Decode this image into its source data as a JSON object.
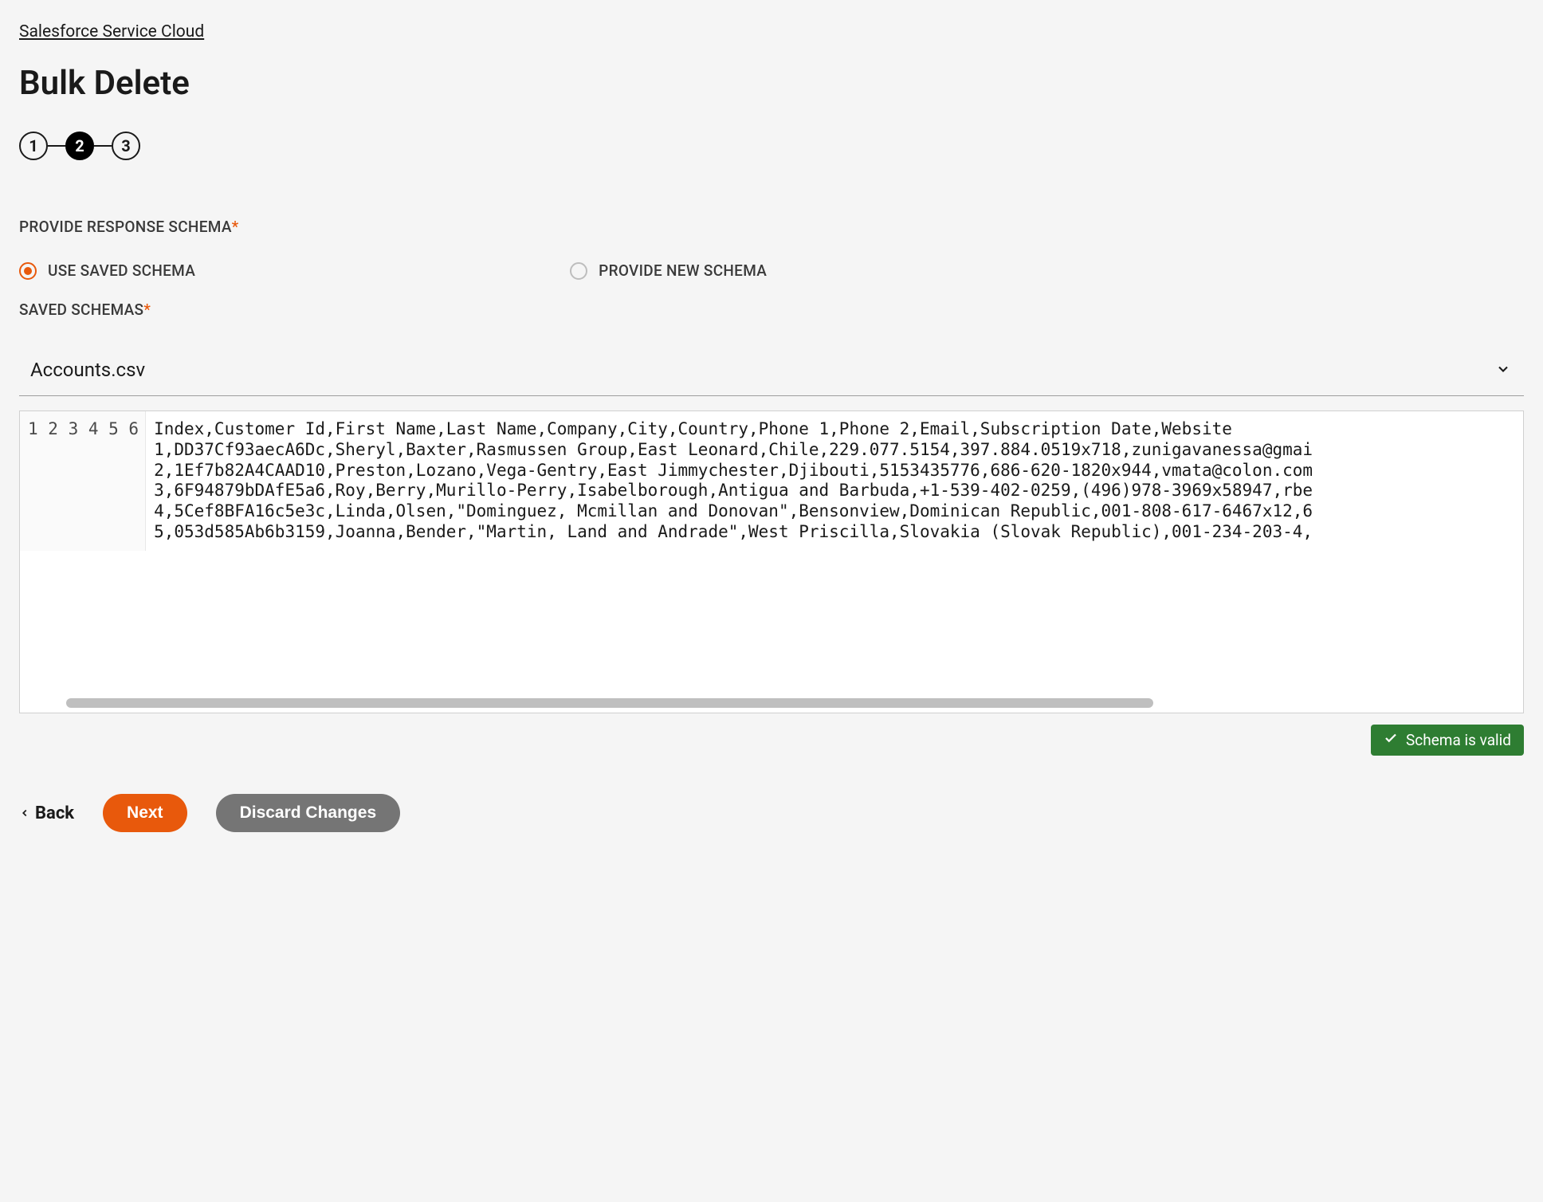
{
  "breadcrumb": "Salesforce Service Cloud",
  "title": "Bulk Delete",
  "stepper": {
    "steps": [
      "1",
      "2",
      "3"
    ],
    "active_index": 1
  },
  "schema_section": {
    "label": "PROVIDE RESPONSE SCHEMA",
    "options": {
      "use_saved": "USE SAVED SCHEMA",
      "provide_new": "PROVIDE NEW SCHEMA"
    },
    "selected": "use_saved",
    "saved_label": "SAVED SCHEMAS",
    "selected_schema": "Accounts.csv"
  },
  "code": {
    "lines": [
      "Index,Customer Id,First Name,Last Name,Company,City,Country,Phone 1,Phone 2,Email,Subscription Date,Website",
      "1,DD37Cf93aecA6Dc,Sheryl,Baxter,Rasmussen Group,East Leonard,Chile,229.077.5154,397.884.0519x718,zunigavanessa@gmai",
      "2,1Ef7b82A4CAAD10,Preston,Lozano,Vega-Gentry,East Jimmychester,Djibouti,5153435776,686-620-1820x944,vmata@colon.com",
      "3,6F94879bDAfE5a6,Roy,Berry,Murillo-Perry,Isabelborough,Antigua and Barbuda,+1-539-402-0259,(496)978-3969x58947,rbe",
      "4,5Cef8BFA16c5e3c,Linda,Olsen,\"Dominguez, Mcmillan and Donovan\",Bensonview,Dominican Republic,001-808-617-6467x12,6",
      "5,053d585Ab6b3159,Joanna,Bender,\"Martin, Land and Andrade\",West Priscilla,Slovakia (Slovak Republic),001-234-203-4,"
    ]
  },
  "validation": {
    "text": "Schema is valid"
  },
  "footer": {
    "back": "Back",
    "next": "Next",
    "discard": "Discard Changes"
  }
}
